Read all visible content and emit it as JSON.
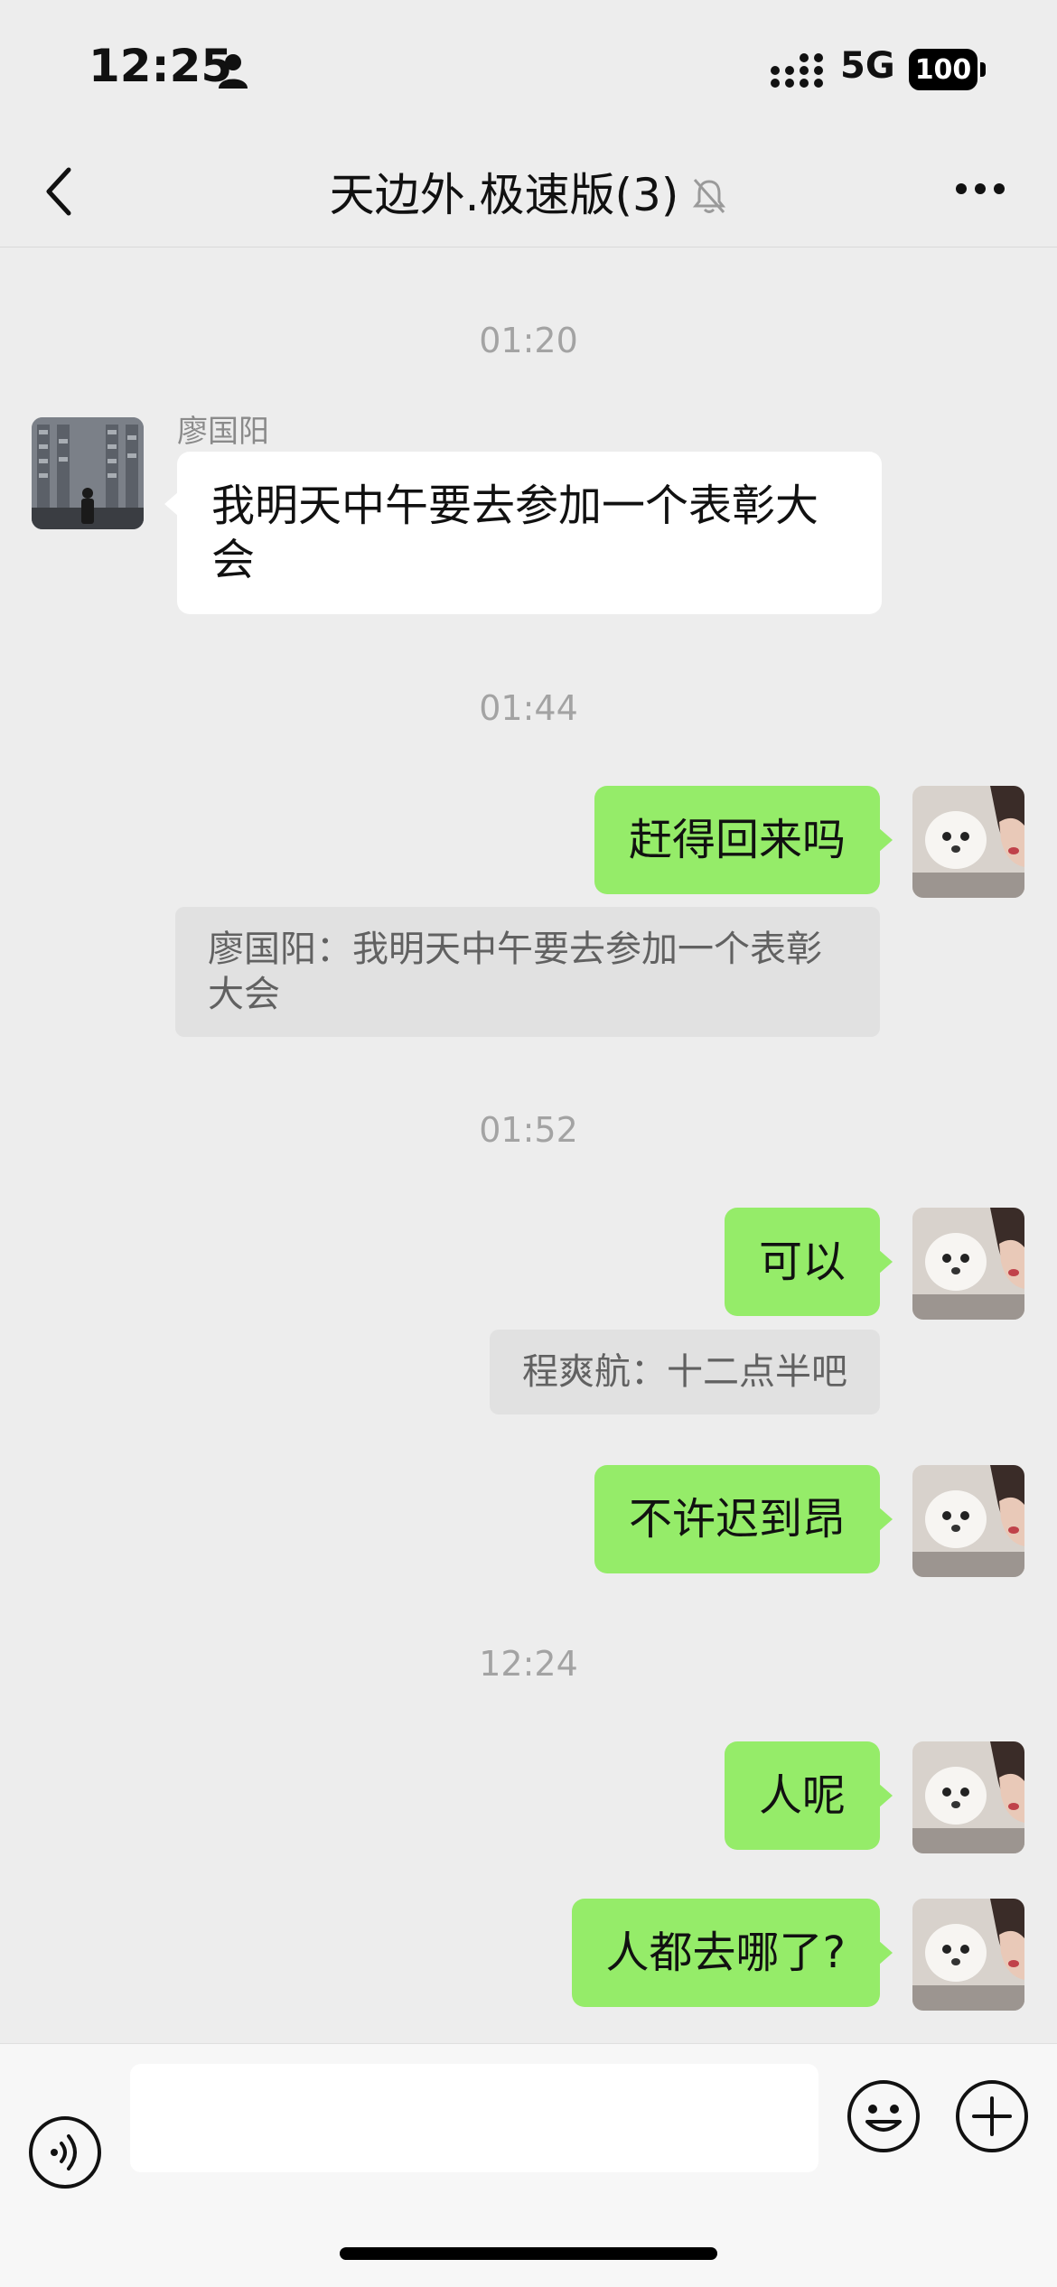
{
  "status_bar": {
    "time": "12:25",
    "network": "5G",
    "battery": "100"
  },
  "nav": {
    "title": "天边外.极速版(3)",
    "icons": [
      "back-icon",
      "mute-bell-icon",
      "more-icon"
    ]
  },
  "messages": {
    "ts1": "01:20",
    "sender1": "廖国阳",
    "in1": "我明天中午要去参加一个表彰大会",
    "ts2": "01:44",
    "out1": "赶得回来吗",
    "quote1": "廖国阳：我明天中午要去参加一个表彰大会",
    "ts3": "01:52",
    "out2": "可以",
    "quote2": "程爽航：十二点半吧",
    "out3": "不许迟到昂",
    "ts4": "12:24",
    "out4": "人呢",
    "out5": "人都去哪了?"
  },
  "input_bar": {
    "placeholder": "",
    "icons": [
      "voice-icon",
      "emoji-icon",
      "plus-icon"
    ]
  },
  "colors": {
    "background": "#ededed",
    "outgoing_bubble": "#95ec69",
    "incoming_bubble": "#ffffff",
    "quote_bg": "#e1e1e1",
    "timestamp": "#a3a3a3"
  }
}
